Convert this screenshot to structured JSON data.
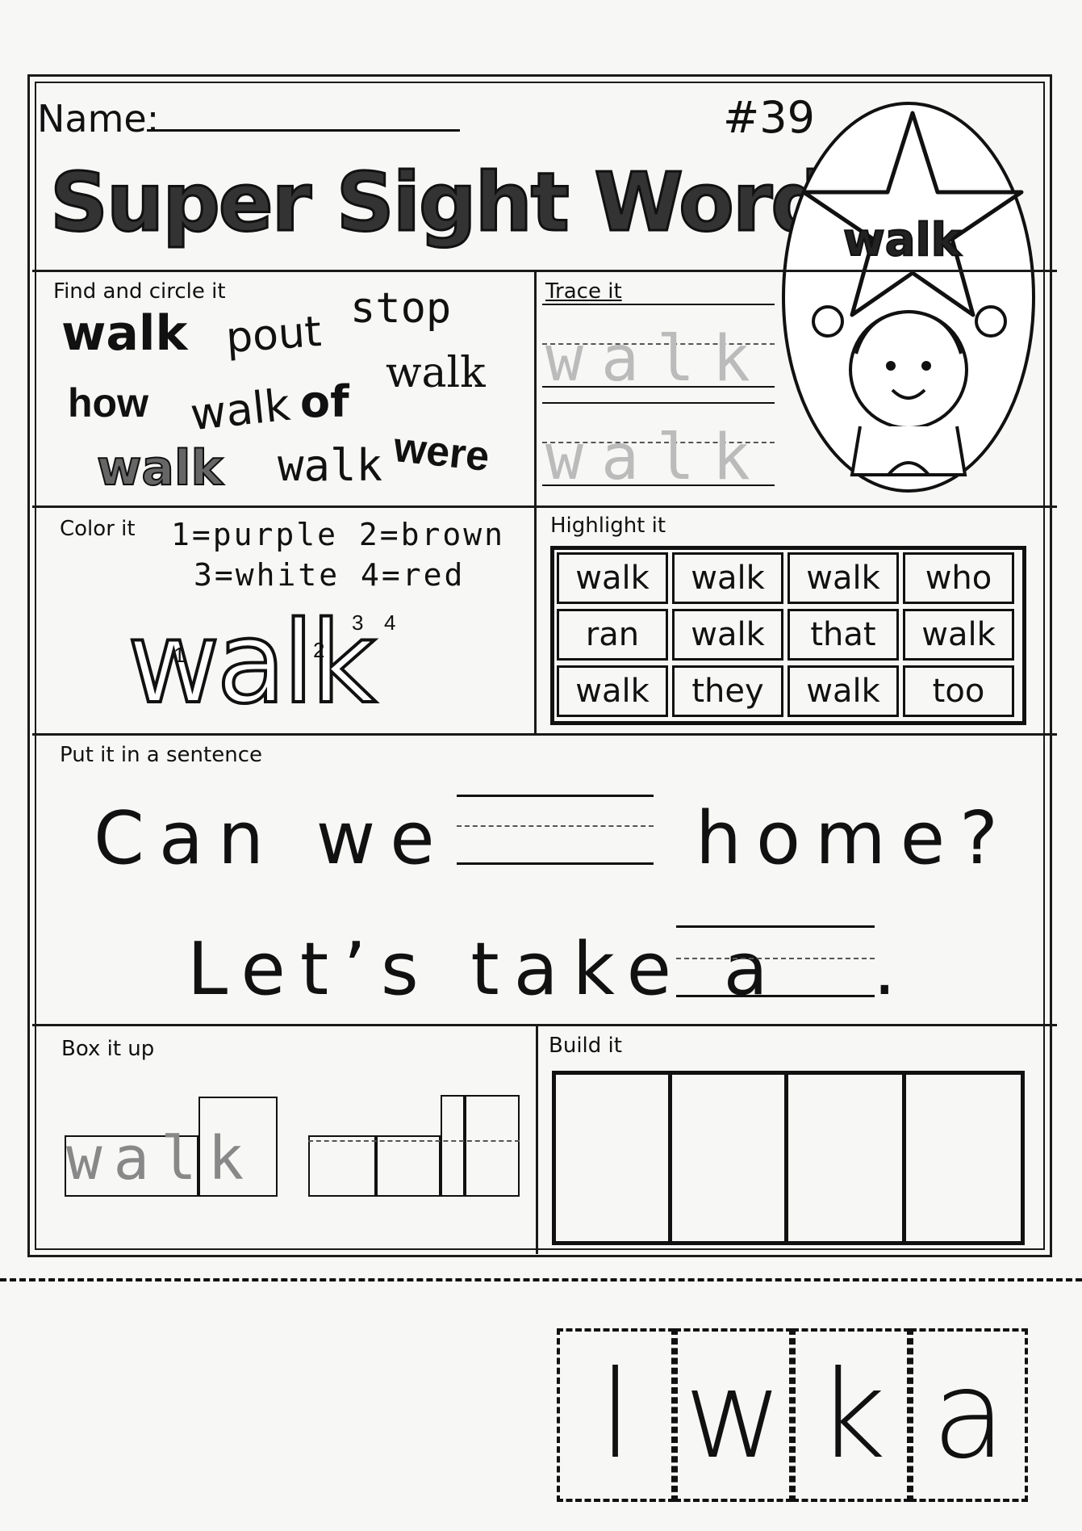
{
  "header": {
    "name_label": "Name:",
    "number": "#39",
    "title": "Super Sight Word:",
    "badge_word": "walk"
  },
  "find_it": {
    "label": "Find and circle it",
    "words": [
      "walk",
      "pout",
      "stop",
      "walk",
      "how",
      "walk",
      "of",
      "were",
      "walk",
      "walk"
    ]
  },
  "trace_it": {
    "label": "Trace it",
    "word": "walk"
  },
  "color_it": {
    "label": "Color it",
    "key_line1": "1=purple 2=brown",
    "key_line2": "3=white 4=red",
    "word": "walk",
    "numbers": [
      "1",
      "2",
      "3",
      "4"
    ]
  },
  "highlight_it": {
    "label": "Highlight it",
    "rows": [
      [
        "walk",
        "walk",
        "walk",
        "who"
      ],
      [
        "ran",
        "walk",
        "that",
        "walk"
      ],
      [
        "walk",
        "they",
        "walk",
        "too"
      ]
    ]
  },
  "sentence": {
    "label": "Put it in a sentence",
    "line1_before": "Can we",
    "line1_after": "home?",
    "line2_before": "Let’s take a",
    "line2_after": "."
  },
  "box_it": {
    "label": "Box it up",
    "word": "walk"
  },
  "build_it": {
    "label": "Build it"
  },
  "cutout_tiles": [
    "l",
    "w",
    "k",
    "a"
  ]
}
